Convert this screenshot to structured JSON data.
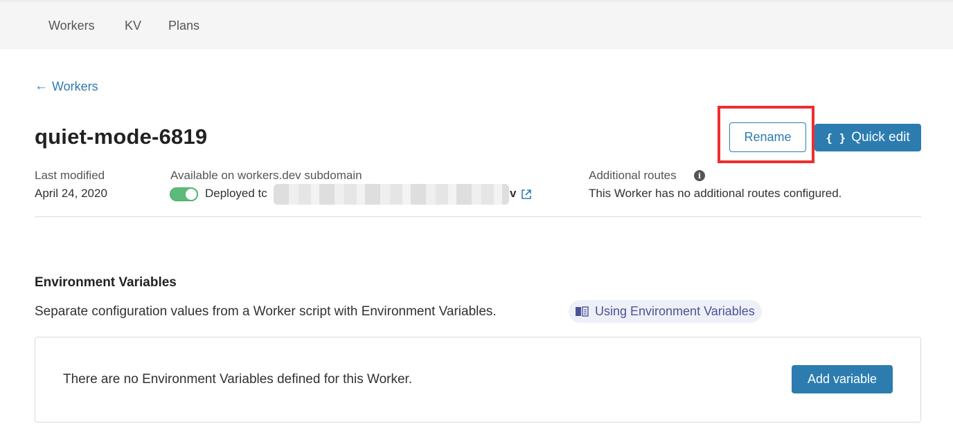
{
  "nav": {
    "items": [
      {
        "label": "Workers"
      },
      {
        "label": "KV"
      },
      {
        "label": "Plans"
      }
    ]
  },
  "back_link": {
    "arrow": "←",
    "label": "Workers"
  },
  "worker": {
    "name": "quiet-mode-6819",
    "rename_label": "Rename",
    "quick_edit_icon": "{ }",
    "quick_edit_label": "Quick edit"
  },
  "meta": {
    "last_modified_label": "Last modified",
    "last_modified_value": "April 24, 2020",
    "subdomain_label": "Available on workers.dev subdomain",
    "subdomain_enabled": true,
    "deployed_prefix": "Deployed tc",
    "deployed_suffix": "v",
    "routes_label": "Additional routes",
    "routes_value": "This Worker has no additional routes configured."
  },
  "env": {
    "title": "Environment Variables",
    "description": "Separate configuration values from a Worker script with Environment Variables.",
    "doc_link": "Using Environment Variables",
    "empty_message": "There are no Environment Variables defined for this Worker.",
    "add_label": "Add variable"
  },
  "colors": {
    "accent": "#2c7cb0",
    "toggle_on": "#5dba7a",
    "highlight": "#ee2e2e"
  }
}
